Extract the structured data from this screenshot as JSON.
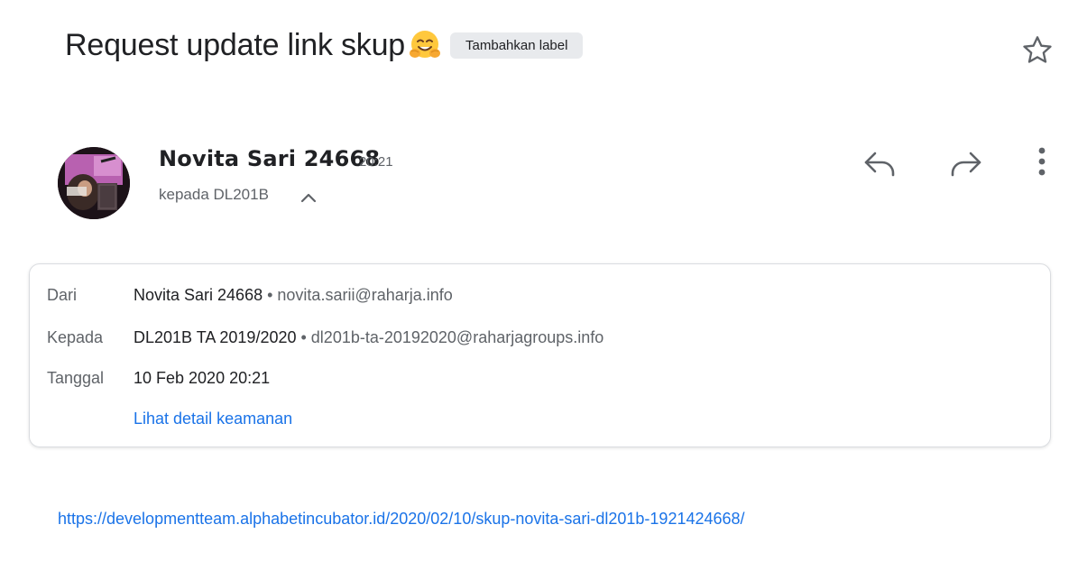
{
  "email": {
    "subject": "Request update link skup",
    "subject_emoji": "hugging-face",
    "label_button": "Tambahkan label"
  },
  "sender": {
    "name": "Novita Sari 24668",
    "time": "20:21",
    "recipient_summary": "kepada DL201B"
  },
  "details": {
    "from_label": "Dari",
    "from_name": "Novita Sari 24668",
    "from_email": "novita.sarii@raharja.info",
    "to_label": "Kepada",
    "to_name": "DL201B TA 2019/2020",
    "to_email": "dl201b-ta-20192020@raharjagroups.info",
    "date_label": "Tanggal",
    "date_value": "10 Feb 2020 20:21",
    "security_link": "Lihat detail keamanan",
    "separator": " • "
  },
  "body": {
    "link": "https://developmentteam.alphabetincubator.id/2020/02/10/skup-novita-sari-dl201b-1921424668/"
  },
  "icons": {
    "star": "star-outline-icon",
    "reply": "reply-icon",
    "forward": "forward-icon",
    "more": "more-vert-icon",
    "chevron": "chevron-up-icon"
  },
  "colors": {
    "link": "#1a73e8",
    "chip_bg": "#e8eaed",
    "muted_text": "#5f6368",
    "border": "#dadce0"
  }
}
